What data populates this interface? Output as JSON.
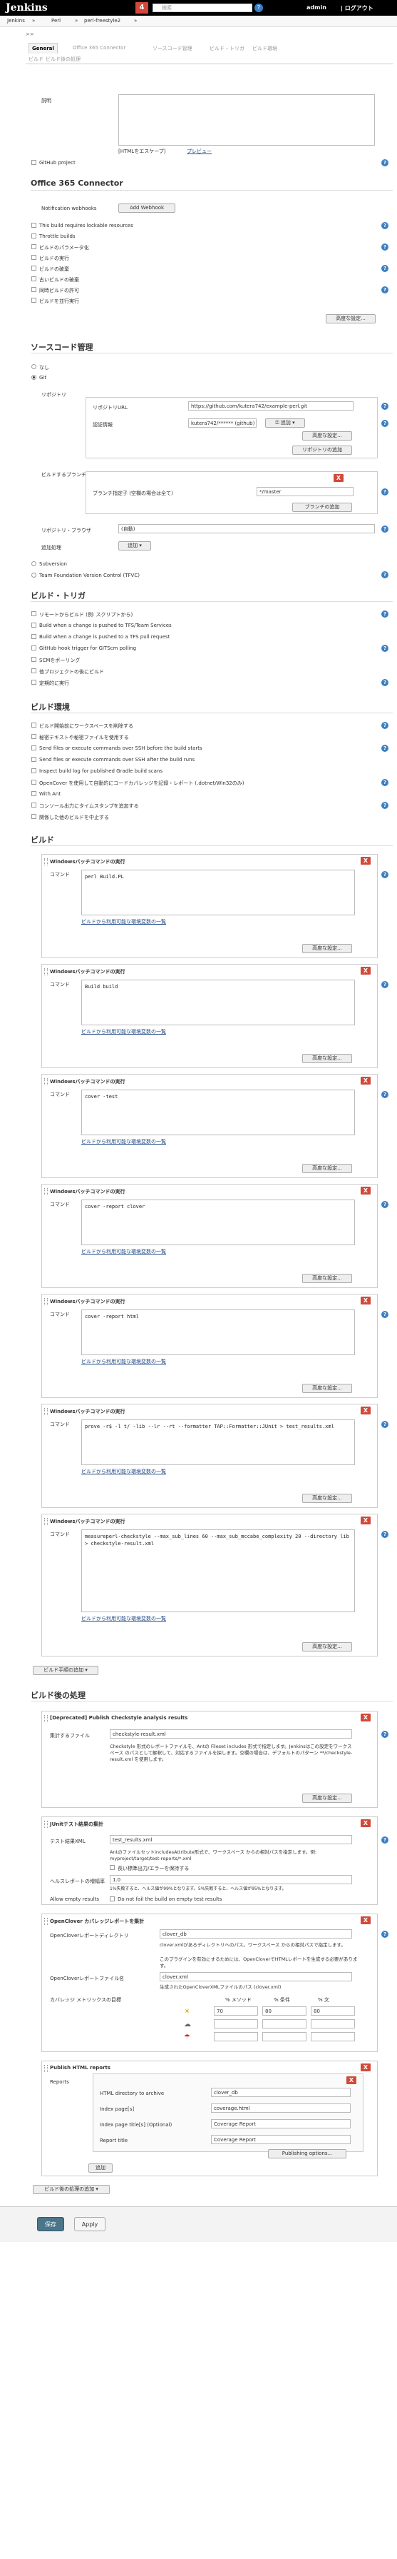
{
  "header": {
    "brand": "Jenkins",
    "notification_count": "4",
    "search_placeholder": "検索",
    "help": "?",
    "admin": "admin",
    "logout": "| ログアウト"
  },
  "breadcrumb": [
    "Jenkins",
    "»",
    "Perl",
    "»",
    "perl-freestyle2",
    "»"
  ],
  "left_markers": [
    ">>"
  ],
  "tabs": [
    "General",
    "Office 365 Connector",
    "ソースコード管理",
    "ビルド・トリガ",
    "ビルド環境",
    "ビルド",
    "ビルド後の処理"
  ],
  "general": {
    "desc_label": "説明",
    "html_escape": "[HTMLをエスケープ]",
    "preview": "プレビュー",
    "github_project": "GitHub project"
  },
  "o365": {
    "title": "Office 365 Connector",
    "webhooks_label": "Notification webhooks",
    "add_webhook": "Add Webhook",
    "checks": [
      "This build requires lockable resources",
      "Throttle builds",
      "ビルドのパラメータ化",
      "ビルドの実行",
      "ビルドの破棄",
      "古いビルドの破棄",
      "同時ビルドの許可",
      "ビルドを並行実行"
    ],
    "advanced": "高度な設定..."
  },
  "scm": {
    "title": "ソースコード管理",
    "none": "なし",
    "git": "Git",
    "repos_label": "リポジトリ",
    "repo_url_label": "リポジトリURL",
    "repo_url": "https://github.com/kutera742/example-perl.git",
    "cred_label": "認証情報",
    "cred_value": "kutera742/****** (github)",
    "add_btn": "追加",
    "advanced": "高度な設定...",
    "add_repo": "リポジトリの追加",
    "branches_label": "ビルドするブランチ",
    "branch_spec_label": "ブランチ指定子 (空欄の場合は全て)",
    "branch_spec": "*/master",
    "add_branch": "ブランチの追加",
    "browser_label": "リポジトリ・ブラウザ",
    "browser_value": "(自動)",
    "extra_label": "追加処理",
    "extra_add": "追加",
    "subversion": "Subversion",
    "tfvc": "Team Foundation Version Control (TFVC)"
  },
  "triggers": {
    "title": "ビルド・トリガ",
    "items": [
      "リモートからビルド (例: スクリプトから)",
      "Build when a change is pushed to TFS/Team Services",
      "Build when a change is pushed to a TFS pull request",
      "GitHub hook trigger for GITScm polling",
      "SCMをポーリング",
      "他プロジェクトの後にビルド",
      "定期的に実行"
    ]
  },
  "env": {
    "title": "ビルド環境",
    "items": [
      "ビルド開始前にワークスペースを削除する",
      "秘密テキストや秘密ファイルを使用する",
      "Send files or execute commands over SSH before the build starts",
      "Send files or execute commands over SSH after the build runs",
      "Inspect build log for published Gradle build scans",
      "OpenCover を使用して自動的にコードカバレッジを記録・レポート (.dotnet/Win32のみ)",
      "With Ant",
      "コンソール出力にタイムスタンプを追加する",
      "関係した他のビルドを中止する"
    ]
  },
  "build": {
    "title": "ビルド",
    "step_title": "Windowsバッチコマンドの実行",
    "command_label": "コマンド",
    "env_link": "ビルドから利用可能な環境変数の一覧",
    "advanced": "高度な設定...",
    "commands": [
      "perl Build.PL",
      "Build build",
      "cover -test",
      "cover -report clover",
      "cover -report html",
      "prove -r$ -l t/ -lib --lr --rt --formatter TAP::Formatter::JUnit > test_results.xml",
      "measureperl-checkstyle --max_sub_lines 60 --max_sub_mccabe_complexity 20 --directory lib > checkstyle-result.xml"
    ],
    "add_step": "ビルド手順の追加"
  },
  "post": {
    "title": "ビルド後の処理",
    "checkstyle": {
      "title": "[Deprecated] Publish Checkstyle analysis results",
      "file_label": "集計するファイル",
      "file": "checkstyle-result.xml",
      "help": "Checkstyle 形式のレポートファイルを、Antの Fileset includes 形式で指定します。Jenkinsはこの設定をワークスペース のパスとして解釈して、対応するファイルを探します。空欄の場合は、デフォルトのパターン **/checkstyle-result.xml を使用します。",
      "advanced": "高度な設定..."
    },
    "junit": {
      "title": "JUnitテスト結果の集計",
      "xml_label": "テスト結果XML",
      "xml": "test_results.xml",
      "help": "AntのファイルセットincludesAttribute形式で、ワークスペース からの相対パスを指定します。例: myproject/target/test-reports/*.xml",
      "retain": "長い標準出力/エラーを保持する",
      "health_label": "ヘルスレポートの増幅率",
      "health": "1.0",
      "health_help": "1%失敗すると、ヘルス値が99%となります。5%失敗すると、ヘルス値が95%となります。",
      "allow_empty": "Allow empty results",
      "allow_empty_text": "Do not fail the build on empty test results"
    },
    "opencover": {
      "title": "OpenClover カバレッジレポートを集計",
      "dir_label": "OpenCloverレポートディレクトリ",
      "dir": "clover_db",
      "dir_help": "clover.xmlがあるディレクトリへのパス。ワークスペース からの相対パスで指定します。",
      "dir_help2": "このプラグインを有効にするためには、OpenCloverでHTMLレポートを生成する必要があります。",
      "xml_label": "OpenCloverレポートファイル名",
      "xml": "clover.xml",
      "xml_help": "生成されたOpenCloverXMLファイルのパス (clover.xml)",
      "metrics_label": "カバレッジ メトリックスの目標",
      "col_method": "% メソッド",
      "col_cond": "% 条件",
      "col_stmt": "% 文",
      "sunny": [
        "70",
        "80",
        "80"
      ],
      "stormy": [
        "",
        "",
        ""
      ],
      "unhealthy": [
        "",
        "",
        ""
      ]
    },
    "html": {
      "title": "Publish HTML reports",
      "reports_label": "Reports",
      "dir_label": "HTML directory to archive",
      "dir": "clover_db",
      "index_label": "Index page[s]",
      "index": "coverage.html",
      "title_label": "Index page title[s] (Optional)",
      "title_val": "Coverage Report",
      "report_label": "Report title",
      "report_val": "Coverage Report",
      "publishing": "Publishing options...",
      "add": "追加"
    },
    "add_post": "ビルド後の処理の追加"
  },
  "footer": {
    "save": "保存",
    "apply": "Apply"
  },
  "colors": {
    "brand": "#d24939",
    "link": "#204a87",
    "help": "#3b7fc4"
  }
}
